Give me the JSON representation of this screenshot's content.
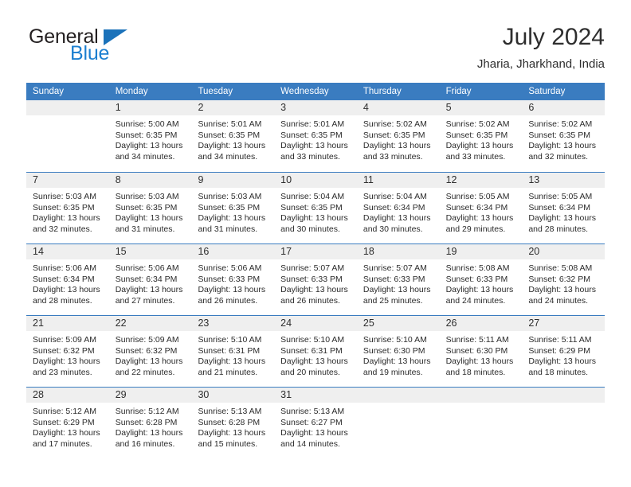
{
  "brand": {
    "name_part1": "General",
    "name_part2": "Blue",
    "triangle_icon": "triangle-icon"
  },
  "header": {
    "title": "July 2024",
    "subtitle": "Jharia, Jharkhand, India",
    "accent_color": "#3a7cc0",
    "brand_blue": "#1c7fd0"
  },
  "calendar": {
    "weekdays": [
      "Sunday",
      "Monday",
      "Tuesday",
      "Wednesday",
      "Thursday",
      "Friday",
      "Saturday"
    ],
    "labels": {
      "sunrise": "Sunrise:",
      "sunset": "Sunset:",
      "daylight": "Daylight:"
    },
    "weeks": [
      [
        {
          "day": "",
          "empty": true
        },
        {
          "day": "1",
          "sunrise": "Sunrise: 5:00 AM",
          "sunset": "Sunset: 6:35 PM",
          "daylight_1": "Daylight: 13 hours",
          "daylight_2": "and 34 minutes."
        },
        {
          "day": "2",
          "sunrise": "Sunrise: 5:01 AM",
          "sunset": "Sunset: 6:35 PM",
          "daylight_1": "Daylight: 13 hours",
          "daylight_2": "and 34 minutes."
        },
        {
          "day": "3",
          "sunrise": "Sunrise: 5:01 AM",
          "sunset": "Sunset: 6:35 PM",
          "daylight_1": "Daylight: 13 hours",
          "daylight_2": "and 33 minutes."
        },
        {
          "day": "4",
          "sunrise": "Sunrise: 5:02 AM",
          "sunset": "Sunset: 6:35 PM",
          "daylight_1": "Daylight: 13 hours",
          "daylight_2": "and 33 minutes."
        },
        {
          "day": "5",
          "sunrise": "Sunrise: 5:02 AM",
          "sunset": "Sunset: 6:35 PM",
          "daylight_1": "Daylight: 13 hours",
          "daylight_2": "and 33 minutes."
        },
        {
          "day": "6",
          "sunrise": "Sunrise: 5:02 AM",
          "sunset": "Sunset: 6:35 PM",
          "daylight_1": "Daylight: 13 hours",
          "daylight_2": "and 32 minutes."
        }
      ],
      [
        {
          "day": "7",
          "sunrise": "Sunrise: 5:03 AM",
          "sunset": "Sunset: 6:35 PM",
          "daylight_1": "Daylight: 13 hours",
          "daylight_2": "and 32 minutes."
        },
        {
          "day": "8",
          "sunrise": "Sunrise: 5:03 AM",
          "sunset": "Sunset: 6:35 PM",
          "daylight_1": "Daylight: 13 hours",
          "daylight_2": "and 31 minutes."
        },
        {
          "day": "9",
          "sunrise": "Sunrise: 5:03 AM",
          "sunset": "Sunset: 6:35 PM",
          "daylight_1": "Daylight: 13 hours",
          "daylight_2": "and 31 minutes."
        },
        {
          "day": "10",
          "sunrise": "Sunrise: 5:04 AM",
          "sunset": "Sunset: 6:35 PM",
          "daylight_1": "Daylight: 13 hours",
          "daylight_2": "and 30 minutes."
        },
        {
          "day": "11",
          "sunrise": "Sunrise: 5:04 AM",
          "sunset": "Sunset: 6:34 PM",
          "daylight_1": "Daylight: 13 hours",
          "daylight_2": "and 30 minutes."
        },
        {
          "day": "12",
          "sunrise": "Sunrise: 5:05 AM",
          "sunset": "Sunset: 6:34 PM",
          "daylight_1": "Daylight: 13 hours",
          "daylight_2": "and 29 minutes."
        },
        {
          "day": "13",
          "sunrise": "Sunrise: 5:05 AM",
          "sunset": "Sunset: 6:34 PM",
          "daylight_1": "Daylight: 13 hours",
          "daylight_2": "and 28 minutes."
        }
      ],
      [
        {
          "day": "14",
          "sunrise": "Sunrise: 5:06 AM",
          "sunset": "Sunset: 6:34 PM",
          "daylight_1": "Daylight: 13 hours",
          "daylight_2": "and 28 minutes."
        },
        {
          "day": "15",
          "sunrise": "Sunrise: 5:06 AM",
          "sunset": "Sunset: 6:34 PM",
          "daylight_1": "Daylight: 13 hours",
          "daylight_2": "and 27 minutes."
        },
        {
          "day": "16",
          "sunrise": "Sunrise: 5:06 AM",
          "sunset": "Sunset: 6:33 PM",
          "daylight_1": "Daylight: 13 hours",
          "daylight_2": "and 26 minutes."
        },
        {
          "day": "17",
          "sunrise": "Sunrise: 5:07 AM",
          "sunset": "Sunset: 6:33 PM",
          "daylight_1": "Daylight: 13 hours",
          "daylight_2": "and 26 minutes."
        },
        {
          "day": "18",
          "sunrise": "Sunrise: 5:07 AM",
          "sunset": "Sunset: 6:33 PM",
          "daylight_1": "Daylight: 13 hours",
          "daylight_2": "and 25 minutes."
        },
        {
          "day": "19",
          "sunrise": "Sunrise: 5:08 AM",
          "sunset": "Sunset: 6:33 PM",
          "daylight_1": "Daylight: 13 hours",
          "daylight_2": "and 24 minutes."
        },
        {
          "day": "20",
          "sunrise": "Sunrise: 5:08 AM",
          "sunset": "Sunset: 6:32 PM",
          "daylight_1": "Daylight: 13 hours",
          "daylight_2": "and 24 minutes."
        }
      ],
      [
        {
          "day": "21",
          "sunrise": "Sunrise: 5:09 AM",
          "sunset": "Sunset: 6:32 PM",
          "daylight_1": "Daylight: 13 hours",
          "daylight_2": "and 23 minutes."
        },
        {
          "day": "22",
          "sunrise": "Sunrise: 5:09 AM",
          "sunset": "Sunset: 6:32 PM",
          "daylight_1": "Daylight: 13 hours",
          "daylight_2": "and 22 minutes."
        },
        {
          "day": "23",
          "sunrise": "Sunrise: 5:10 AM",
          "sunset": "Sunset: 6:31 PM",
          "daylight_1": "Daylight: 13 hours",
          "daylight_2": "and 21 minutes."
        },
        {
          "day": "24",
          "sunrise": "Sunrise: 5:10 AM",
          "sunset": "Sunset: 6:31 PM",
          "daylight_1": "Daylight: 13 hours",
          "daylight_2": "and 20 minutes."
        },
        {
          "day": "25",
          "sunrise": "Sunrise: 5:10 AM",
          "sunset": "Sunset: 6:30 PM",
          "daylight_1": "Daylight: 13 hours",
          "daylight_2": "and 19 minutes."
        },
        {
          "day": "26",
          "sunrise": "Sunrise: 5:11 AM",
          "sunset": "Sunset: 6:30 PM",
          "daylight_1": "Daylight: 13 hours",
          "daylight_2": "and 18 minutes."
        },
        {
          "day": "27",
          "sunrise": "Sunrise: 5:11 AM",
          "sunset": "Sunset: 6:29 PM",
          "daylight_1": "Daylight: 13 hours",
          "daylight_2": "and 18 minutes."
        }
      ],
      [
        {
          "day": "28",
          "sunrise": "Sunrise: 5:12 AM",
          "sunset": "Sunset: 6:29 PM",
          "daylight_1": "Daylight: 13 hours",
          "daylight_2": "and 17 minutes."
        },
        {
          "day": "29",
          "sunrise": "Sunrise: 5:12 AM",
          "sunset": "Sunset: 6:28 PM",
          "daylight_1": "Daylight: 13 hours",
          "daylight_2": "and 16 minutes."
        },
        {
          "day": "30",
          "sunrise": "Sunrise: 5:13 AM",
          "sunset": "Sunset: 6:28 PM",
          "daylight_1": "Daylight: 13 hours",
          "daylight_2": "and 15 minutes."
        },
        {
          "day": "31",
          "sunrise": "Sunrise: 5:13 AM",
          "sunset": "Sunset: 6:27 PM",
          "daylight_1": "Daylight: 13 hours",
          "daylight_2": "and 14 minutes."
        },
        {
          "day": "",
          "empty": true
        },
        {
          "day": "",
          "empty": true
        },
        {
          "day": "",
          "empty": true
        }
      ]
    ]
  }
}
